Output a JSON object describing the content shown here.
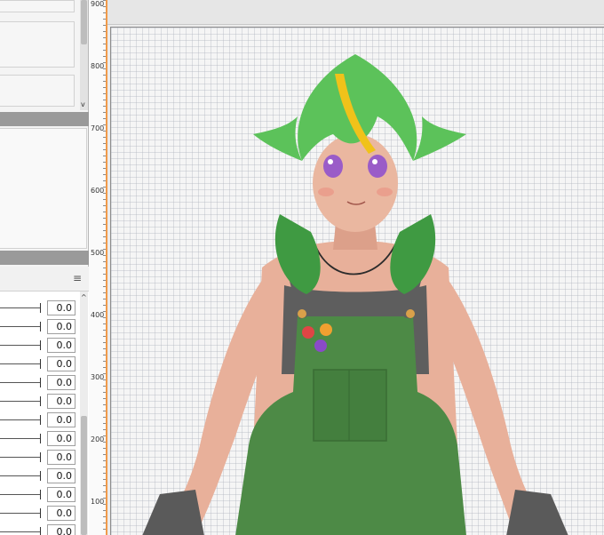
{
  "ruler": {
    "labels": [
      "900",
      "800",
      "700",
      "600",
      "500",
      "400",
      "300",
      "200",
      "100"
    ]
  },
  "properties": {
    "menu_icon": "hamburger-menu-icon",
    "values": [
      "0.0",
      "0.0",
      "0.0",
      "0.0",
      "0.0",
      "0.0",
      "0.0",
      "0.0",
      "0.0",
      "0.0",
      "0.0",
      "0.0",
      "0.0"
    ]
  },
  "colors": {
    "hair": "#5cc25a",
    "hair_dark": "#3f9a42",
    "hair_streak": "#f0c21a",
    "skin": "#e8b09a",
    "overalls": "#4d8a46",
    "tank_top": "#5e5e5e",
    "gloves": "#5a5a5a",
    "eyes": "#9a5cc8",
    "guide": "#f09a4a"
  }
}
